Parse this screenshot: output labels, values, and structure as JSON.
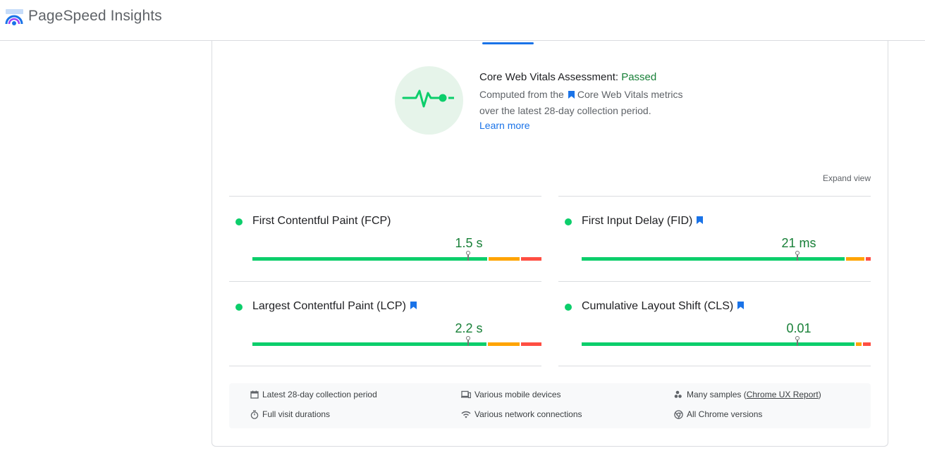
{
  "header": {
    "brand": "PageSpeed Insights"
  },
  "assessment": {
    "title_prefix": "Core Web Vitals Assessment: ",
    "status": "Passed",
    "line1_prefix": "Computed from the",
    "line1_suffix": "Core Web Vitals metrics",
    "line2": "over the latest 28-day collection period.",
    "learn_more": "Learn more"
  },
  "expand_view": "Expand view",
  "metrics": [
    {
      "label": "First Contentful Paint (FCP)",
      "value": "1.5 s",
      "bookmark": false,
      "marker_pct": 74.6,
      "good_pct": 81.5,
      "ni_pct": 11.2
    },
    {
      "label": "First Input Delay (FID)",
      "value": "21 ms",
      "bookmark": true,
      "marker_pct": 74.6,
      "good_pct": 91.2,
      "ni_pct": 6.6
    },
    {
      "label": "Largest Contentful Paint (LCP)",
      "value": "2.2 s",
      "bookmark": true,
      "marker_pct": 74.6,
      "good_pct": 81.2,
      "ni_pct": 11.5
    },
    {
      "label": "Cumulative Layout Shift (CLS)",
      "value": "0.01",
      "bookmark": true,
      "marker_pct": 74.6,
      "good_pct": 94.9,
      "ni_pct": 2.4
    }
  ],
  "info": {
    "period": "Latest 28-day collection period",
    "durations": "Full visit durations",
    "devices": "Various mobile devices",
    "network": "Various network connections",
    "samples_prefix": "Many samples (",
    "samples_link": "Chrome UX Report",
    "samples_suffix": ")",
    "chrome": "All Chrome versions"
  },
  "colors": {
    "good": "#0cce6b",
    "needs_improvement": "#ffa400",
    "poor": "#ff4e42",
    "accent": "#1a73e8",
    "pass_text": "#188038"
  }
}
